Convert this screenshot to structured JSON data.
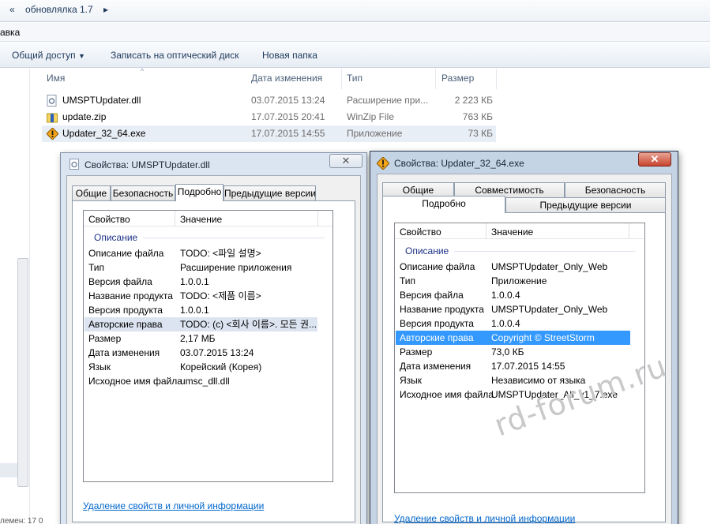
{
  "explorer": {
    "breadcrumb": [
      "«",
      "обновлялка 1.7",
      "▸"
    ],
    "menu_label": "авка",
    "toolbar": {
      "share": "Общий доступ",
      "burn": "Записать на оптический диск",
      "newfolder": "Новая папка"
    },
    "columns": {
      "name": "Имя",
      "date": "Дата изменения",
      "type": "Тип",
      "size": "Размер"
    },
    "files": [
      {
        "name": "UMSPTUpdater.dll",
        "date": "03.07.2015 13:24",
        "type": "Расширение при...",
        "size": "2 223 КБ"
      },
      {
        "name": "update.zip",
        "date": "17.07.2015 20:41",
        "type": "WinZip File",
        "size": "763 КБ"
      },
      {
        "name": "Updater_32_64.exe",
        "date": "17.07.2015 14:55",
        "type": "Приложение",
        "size": "73 КБ"
      }
    ],
    "status": "лемен: 17 0"
  },
  "dialog1": {
    "title": "Свойства: UMSPTUpdater.dll",
    "close": "✕",
    "tabs": [
      "Общие",
      "Безопасность",
      "Подробно",
      "Предыдущие версии"
    ],
    "grid_headers": {
      "prop": "Свойство",
      "value": "Значение"
    },
    "section": "Описание",
    "rows": [
      {
        "k": "Описание файла",
        "v": "TODO: <파일 설명>"
      },
      {
        "k": "Тип",
        "v": "Расширение приложения"
      },
      {
        "k": "Версия файла",
        "v": "1.0.0.1"
      },
      {
        "k": "Название продукта",
        "v": "TODO: <제품 이름>"
      },
      {
        "k": "Версия продукта",
        "v": "1.0.0.1"
      },
      {
        "k": "Авторские права",
        "v": "TODO: (c) <회사 이름>. 모든 권..."
      },
      {
        "k": "Размер",
        "v": "2,17 МБ"
      },
      {
        "k": "Дата изменения",
        "v": "03.07.2015 13:24"
      },
      {
        "k": "Язык",
        "v": "Корейский (Корея)"
      },
      {
        "k": "Исходное имя файла",
        "v": "umsc_dll.dll"
      }
    ],
    "link": "Удаление свойств и личной информации"
  },
  "dialog2": {
    "title": "Свойства: Updater_32_64.exe",
    "close": "✕",
    "tabs_row1": [
      "Общие",
      "Совместимость",
      "Безопасность"
    ],
    "tabs_row2": [
      "Подробно",
      "Предыдущие версии"
    ],
    "grid_headers": {
      "prop": "Свойство",
      "value": "Значение"
    },
    "section": "Описание",
    "rows": [
      {
        "k": "Описание файла",
        "v": "UMSPTUpdater_Only_Web"
      },
      {
        "k": "Тип",
        "v": "Приложение"
      },
      {
        "k": "Версия файла",
        "v": "1.0.0.4"
      },
      {
        "k": "Название продукта",
        "v": "UMSPTUpdater_Only_Web"
      },
      {
        "k": "Версия продукта",
        "v": "1.0.0.4"
      },
      {
        "k": "Авторские права",
        "v": "Copyright © StreetStorm"
      },
      {
        "k": "Размер",
        "v": "73,0 КБ"
      },
      {
        "k": "Дата изменения",
        "v": "17.07.2015 14:55"
      },
      {
        "k": "Язык",
        "v": "Независимо от языка"
      },
      {
        "k": "Исходное имя файла",
        "v": "UMSPTUpdater_All_v1_7.exe"
      }
    ],
    "link": "Удаление свойств и личной информации"
  },
  "watermark": "rd-forum.ru",
  "colors": {
    "selection_blue": "#3399ff",
    "link": "#0066cc",
    "section": "#1e3287"
  }
}
